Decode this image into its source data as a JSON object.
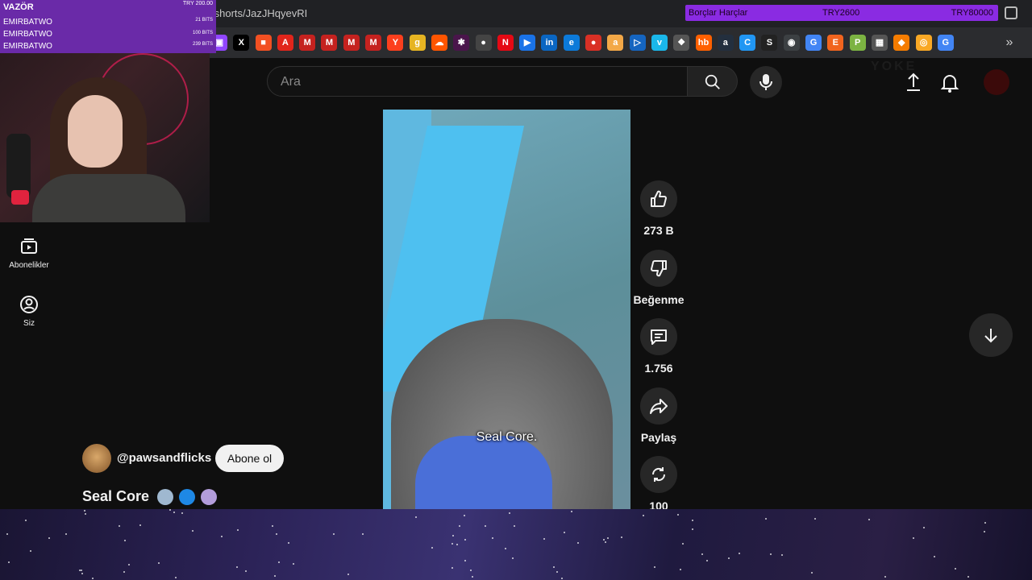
{
  "browser": {
    "url": "/shorts/JazJHqyevRI",
    "goal": {
      "title": "Borçlar Harçlar",
      "current": "TRY2600",
      "target": "TRY80000"
    },
    "bookmarks": [
      {
        "name": "twitch-bookmark",
        "glyph": "▣",
        "color": "#9146ff"
      },
      {
        "name": "x-bookmark",
        "glyph": "X",
        "color": "#000000"
      },
      {
        "name": "microsoft-bookmark",
        "glyph": "■",
        "color": "#f25022"
      },
      {
        "name": "adobe-bookmark",
        "glyph": "A",
        "color": "#e1251b"
      },
      {
        "name": "gmail-bookmark",
        "glyph": "M",
        "color": "#c5221f"
      },
      {
        "name": "gmail-bookmark-2",
        "glyph": "M",
        "color": "#c5221f"
      },
      {
        "name": "gmail-bookmark-3",
        "glyph": "M",
        "color": "#c5221f"
      },
      {
        "name": "gmail-bookmark-4",
        "glyph": "M",
        "color": "#c5221f"
      },
      {
        "name": "yandex-bookmark",
        "glyph": "Y",
        "color": "#fc3f1d"
      },
      {
        "name": "g-bookmark",
        "glyph": "g",
        "color": "#e6b422"
      },
      {
        "name": "soundcloud-bookmark",
        "glyph": "☁",
        "color": "#ff5500"
      },
      {
        "name": "slack-bookmark",
        "glyph": "✱",
        "color": "#4a154b"
      },
      {
        "name": "apple-bookmark",
        "glyph": "●",
        "color": "#444444"
      },
      {
        "name": "netflix-bookmark",
        "glyph": "N",
        "color": "#e50914"
      },
      {
        "name": "play-bookmark",
        "glyph": "▶",
        "color": "#1a73e8"
      },
      {
        "name": "linkedin-bookmark",
        "glyph": "in",
        "color": "#0a66c2"
      },
      {
        "name": "edge-bookmark",
        "glyph": "e",
        "color": "#0c7ad9"
      },
      {
        "name": "record-bookmark",
        "glyph": "●",
        "color": "#d93025"
      },
      {
        "name": "amazon-bookmark",
        "glyph": "a",
        "color": "#f3a847"
      },
      {
        "name": "play-store-bookmark",
        "glyph": "▷",
        "color": "#1565c0"
      },
      {
        "name": "vimeo-bookmark",
        "glyph": "v",
        "color": "#1ab7ea"
      },
      {
        "name": "extension-bookmark",
        "glyph": "❖",
        "color": "#555555"
      },
      {
        "name": "hb-bookmark",
        "glyph": "hb",
        "color": "#ff6000"
      },
      {
        "name": "amazon-bookmark-2",
        "glyph": "a",
        "color": "#232f3e"
      },
      {
        "name": "c-bookmark",
        "glyph": "C",
        "color": "#2196f3"
      },
      {
        "name": "s-bookmark",
        "glyph": "S",
        "color": "#222222"
      },
      {
        "name": "chrome-bookmark",
        "glyph": "◉",
        "color": "#3c4043"
      },
      {
        "name": "google-bookmark",
        "glyph": "G",
        "color": "#4285f4"
      },
      {
        "name": "etsy-bookmark",
        "glyph": "E",
        "color": "#f1641e"
      },
      {
        "name": "p-bookmark",
        "glyph": "P",
        "color": "#7cb342"
      },
      {
        "name": "spreadsheet-bookmark",
        "glyph": "▦",
        "color": "#555555"
      },
      {
        "name": "orange-bookmark",
        "glyph": "◆",
        "color": "#f57c00"
      },
      {
        "name": "gold-bookmark",
        "glyph": "◎",
        "color": "#f9a825"
      },
      {
        "name": "google-bookmark-2",
        "glyph": "G",
        "color": "#4285f4"
      }
    ]
  },
  "stream_overlay": {
    "alert_name": "VAZÖR",
    "alert_amount": "TRY 200.00",
    "rows": [
      {
        "name": "EMIRBATWO",
        "bits": "21 BITS"
      },
      {
        "name": "EMIRBATWO",
        "bits": "100 BITS"
      },
      {
        "name": "EMIRBATWO",
        "bits": "239 BITS"
      }
    ]
  },
  "header": {
    "search_placeholder": "Ara",
    "brand_overlay": "YOKE"
  },
  "sidebar": {
    "items": [
      {
        "label": "Abonelikler"
      },
      {
        "label": "Siz"
      }
    ]
  },
  "short": {
    "caption": "Seal Core.",
    "title": "Seal Core",
    "channel": "@pawsandflicks",
    "subscribe": "Abone ol",
    "emoji_colors": [
      "#9fb8d0",
      "#1e88e5",
      "#b39ddb"
    ]
  },
  "actions": {
    "like": "273 B",
    "dislike": "Beğenme",
    "comments": "1.756",
    "share": "Paylaş",
    "remix": "100"
  },
  "colors": {
    "background": "#0f0f0f",
    "goal_bar": "#8a2be2",
    "overlay_purple": "#6a2aa8",
    "button": "#272727"
  }
}
